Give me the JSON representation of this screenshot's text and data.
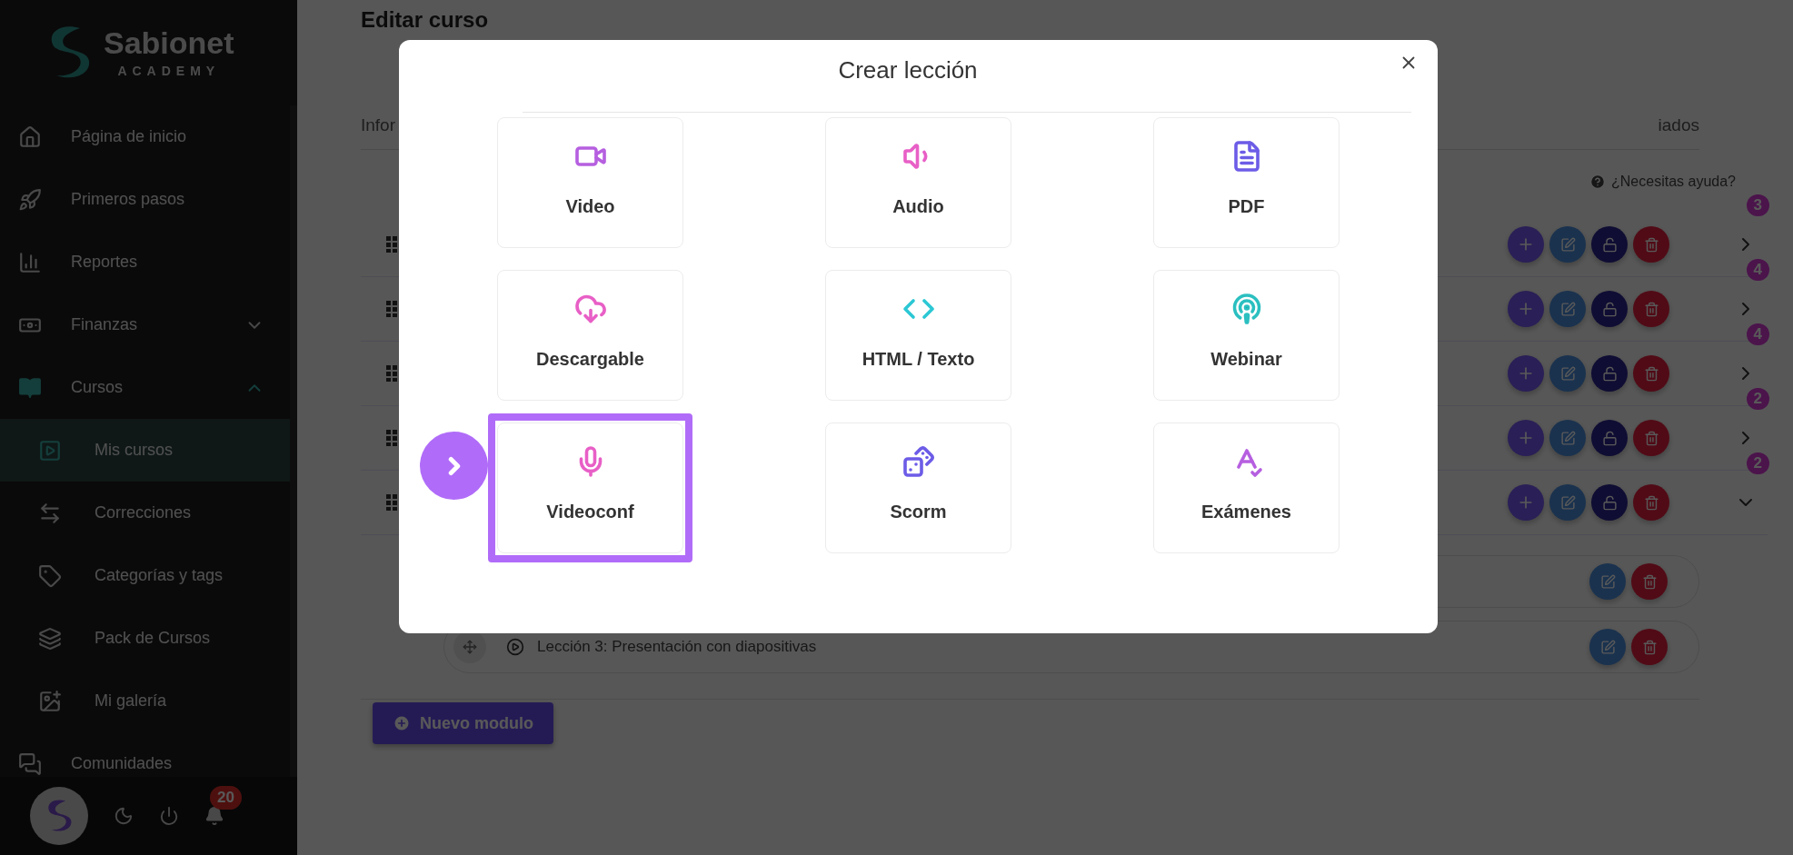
{
  "sidebar": {
    "logo": {
      "name": "Sabionet",
      "subtitle": "ACADEMY"
    },
    "items": [
      {
        "label": "Página de inicio",
        "selected": false
      },
      {
        "label": "Primeros pasos",
        "selected": false
      },
      {
        "label": "Reportes",
        "selected": false
      },
      {
        "label": "Finanzas",
        "selected": false,
        "expanded": false
      },
      {
        "label": "Cursos",
        "selected": false,
        "expanded": true,
        "children": [
          {
            "label": "Mis cursos",
            "selected": true
          },
          {
            "label": "Correcciones",
            "selected": false
          },
          {
            "label": "Categorías y tags",
            "selected": false
          },
          {
            "label": "Pack de Cursos",
            "selected": false
          },
          {
            "label": "Mi galería",
            "selected": false
          }
        ]
      },
      {
        "label": "Comunidades",
        "selected": false
      }
    ],
    "notifications": "20"
  },
  "main": {
    "title": "Editar curso",
    "tabs": [
      "Infor",
      "iados"
    ],
    "help": "¿Necesitas ayuda?",
    "modules": [
      {
        "count": "3",
        "expanded": false
      },
      {
        "count": "4",
        "expanded": false
      },
      {
        "count": "4",
        "expanded": false
      },
      {
        "count": "2",
        "expanded": false
      },
      {
        "count": "2",
        "expanded": true,
        "lessons": [
          {
            "kind": "covered"
          },
          {
            "kind": "full",
            "title": "Lección 3: Presentación con diapositivas"
          }
        ]
      }
    ],
    "new_module_button": "Nuevo modulo"
  },
  "modal": {
    "title": "Crear lección",
    "cards": [
      {
        "label": "Video",
        "highlighted": false
      },
      {
        "label": "Audio",
        "highlighted": false
      },
      {
        "label": "PDF",
        "highlighted": false
      },
      {
        "label": "Descargable",
        "highlighted": false
      },
      {
        "label": "HTML / Texto",
        "highlighted": false
      },
      {
        "label": "Webinar",
        "highlighted": false
      },
      {
        "label": "Videoconf",
        "highlighted": true
      },
      {
        "label": "Scorm",
        "highlighted": false
      },
      {
        "label": "Exámenes",
        "highlighted": false
      }
    ]
  }
}
